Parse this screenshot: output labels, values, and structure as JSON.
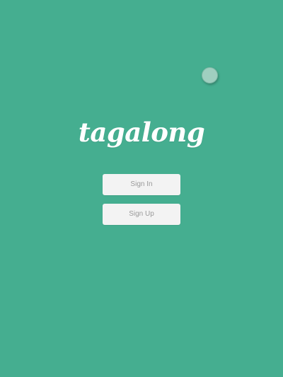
{
  "app": {
    "logo_text": "tagalong"
  },
  "actions": {
    "sign_in_label": "Sign In",
    "sign_up_label": "Sign Up"
  },
  "colors": {
    "background": "#45ae90",
    "button_bg": "#f3f3f3",
    "button_text": "#9a9a9a",
    "logo_text": "#ffffff"
  },
  "icons": {
    "touch_indicator": "touch-indicator-icon"
  }
}
